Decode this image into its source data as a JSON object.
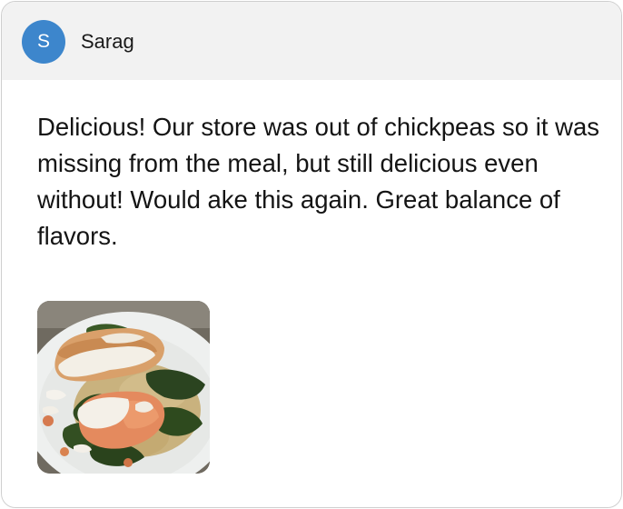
{
  "review": {
    "author_initial": "S",
    "author_name": "Sarag",
    "text": "Delicious! Our store was out of chickpeas so it was missing from the meal, but still delicious even without! Would ake this again. Great balance of flavors.",
    "photo_alt": "Photo of salmon with white sauce over spinach and quinoa"
  },
  "colors": {
    "avatar": "#3d86cc",
    "header_bg": "#f2f2f2",
    "border": "#cfcfcf"
  }
}
